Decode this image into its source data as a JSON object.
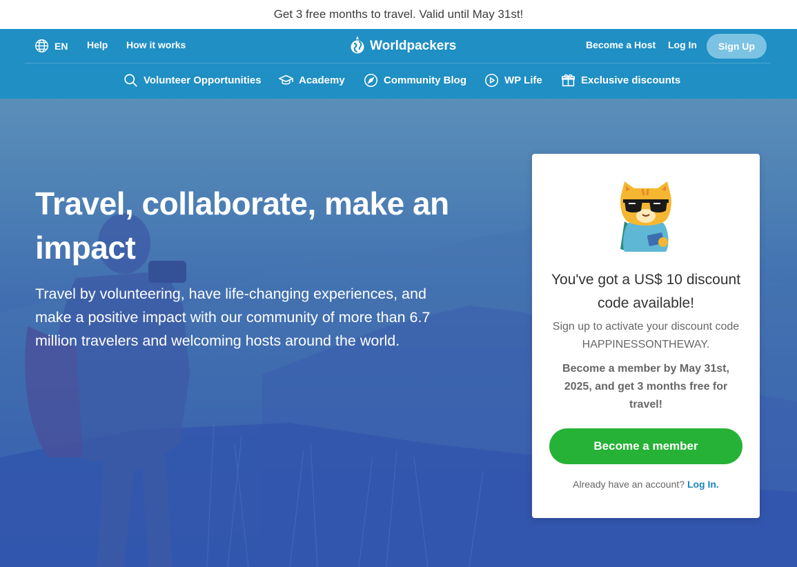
{
  "promo": {
    "text": "Get 3 free months to travel. Valid until May 31st!"
  },
  "header": {
    "lang": "EN",
    "help": "Help",
    "how_it_works": "How it works",
    "logo": "Worldpackers",
    "become_host": "Become a Host",
    "login": "Log In",
    "signup": "Sign Up"
  },
  "nav": [
    {
      "label": "Volunteer Opportunities",
      "icon": "search-icon"
    },
    {
      "label": "Academy",
      "icon": "graduation-cap-icon"
    },
    {
      "label": "Community Blog",
      "icon": "compass-icon"
    },
    {
      "label": "WP Life",
      "icon": "play-circle-icon"
    },
    {
      "label": "Exclusive discounts",
      "icon": "gift-icon"
    }
  ],
  "hero": {
    "headline": "Travel, collaborate, make an impact",
    "subtext": "Travel by volunteering, have life-changing experiences, and make a positive impact with our community of more than 6.7 million travelers and welcoming hosts around the world."
  },
  "card": {
    "title": "You've got a US$ 10 discount code available!",
    "subtitle": "Sign up to activate your discount code HAPPINESSONTHEWAY.",
    "note": "Become a member by May 31st, 2025, and get 3 months free for travel!",
    "button": "Become a member",
    "login_prompt": "Already have an account?",
    "login_link": "Log In."
  },
  "colors": {
    "header": "#1f8fc4",
    "signup_button": "#7cc3e3",
    "member_button": "#26b236",
    "link": "#1a86c0"
  }
}
